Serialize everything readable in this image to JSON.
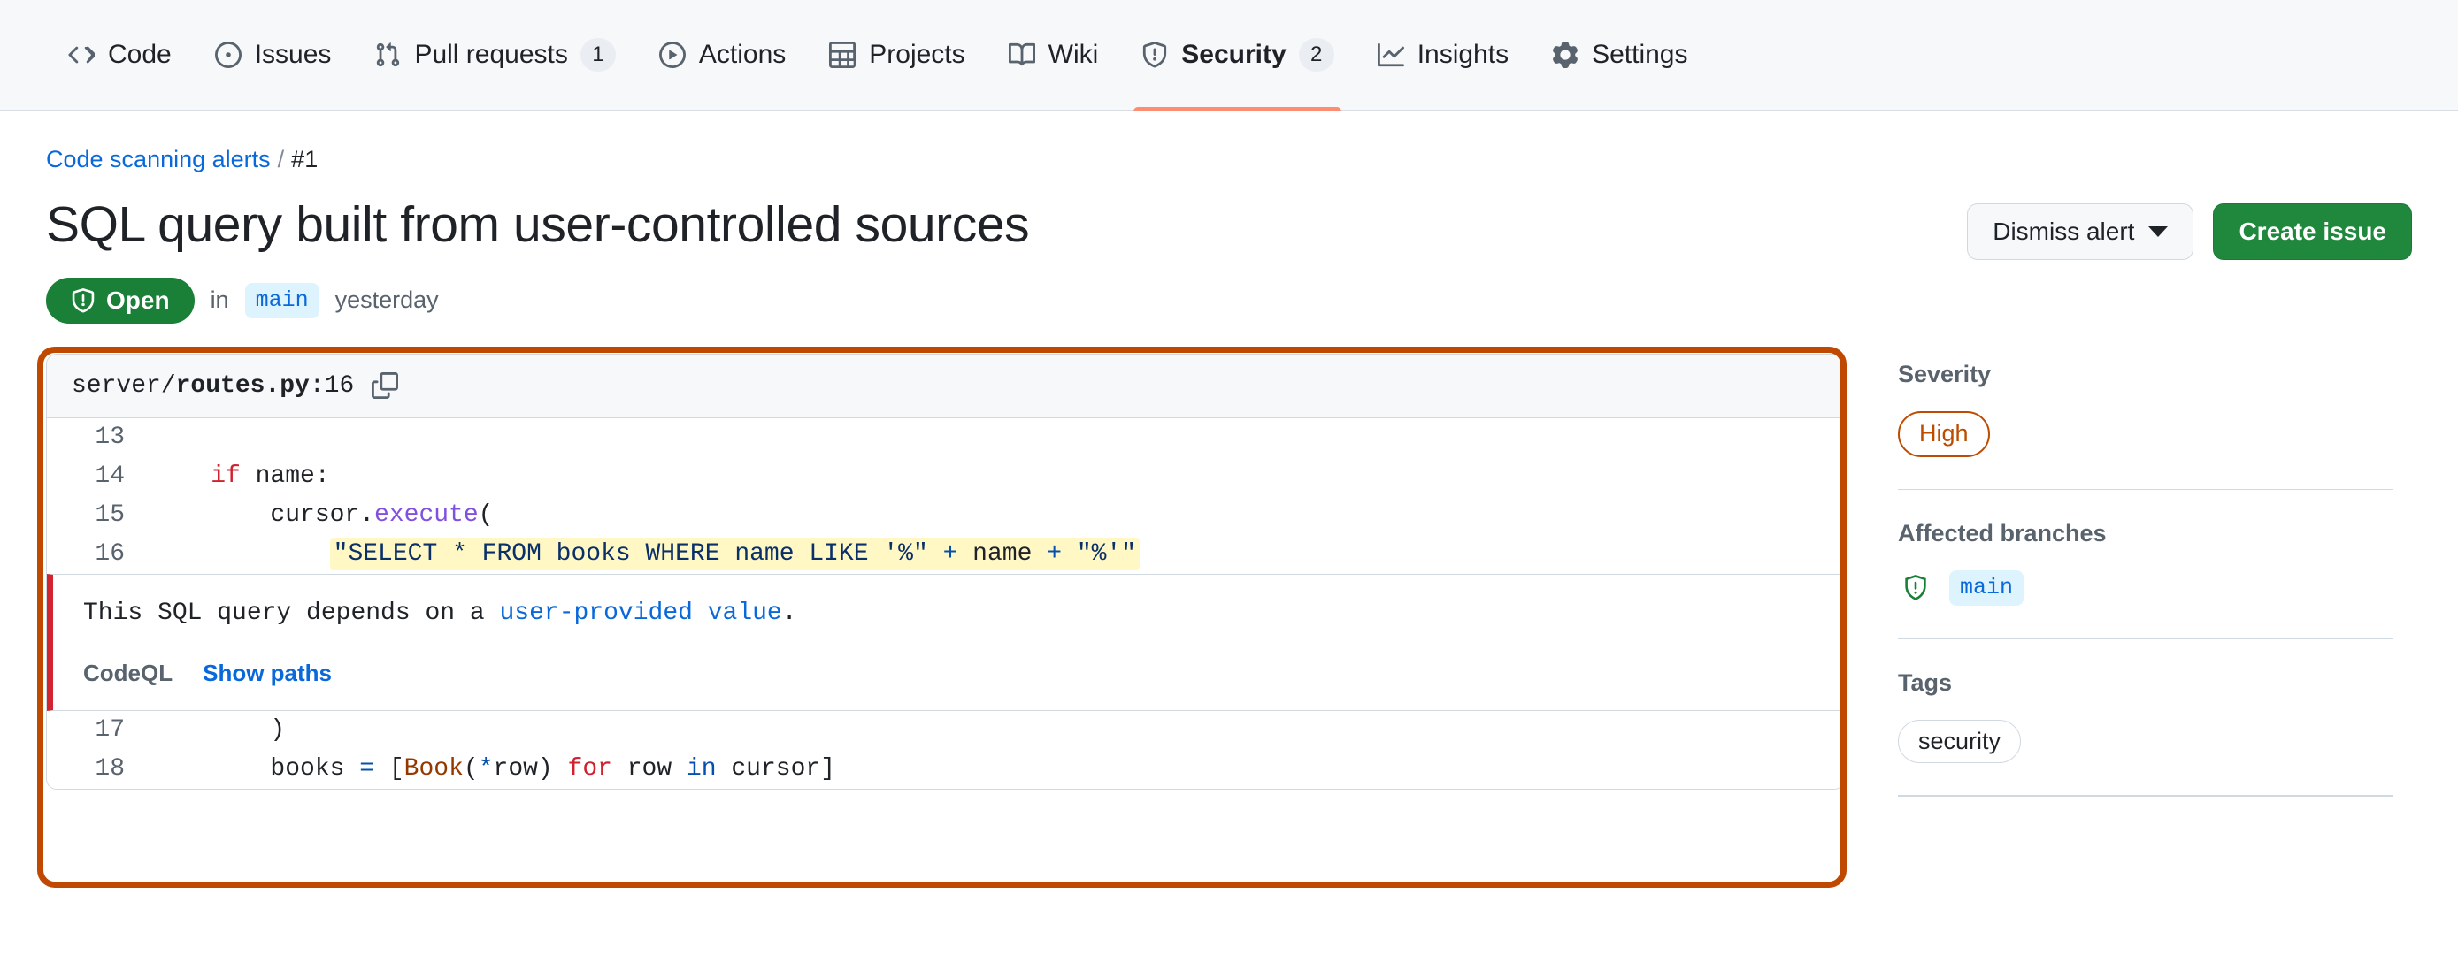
{
  "nav": {
    "tabs": [
      {
        "label": "Code",
        "icon": "code-icon",
        "count": null,
        "active": false
      },
      {
        "label": "Issues",
        "icon": "issue-opened-icon",
        "count": null,
        "active": false
      },
      {
        "label": "Pull requests",
        "icon": "git-pull-request-icon",
        "count": "1",
        "active": false
      },
      {
        "label": "Actions",
        "icon": "play-icon",
        "count": null,
        "active": false
      },
      {
        "label": "Projects",
        "icon": "table-icon",
        "count": null,
        "active": false
      },
      {
        "label": "Wiki",
        "icon": "book-icon",
        "count": null,
        "active": false
      },
      {
        "label": "Security",
        "icon": "shield-icon",
        "count": "2",
        "active": true
      },
      {
        "label": "Insights",
        "icon": "graph-icon",
        "count": null,
        "active": false
      },
      {
        "label": "Settings",
        "icon": "gear-icon",
        "count": null,
        "active": false
      }
    ]
  },
  "breadcrumb": {
    "parent": "Code scanning alerts",
    "separator": "/",
    "current": "#1"
  },
  "header": {
    "title": "SQL query built from user-controlled sources",
    "state": "Open",
    "in_word": "in",
    "branch": "main",
    "time": "yesterday",
    "dismiss_label": "Dismiss alert",
    "create_issue_label": "Create issue"
  },
  "code_panel": {
    "path_prefix": "server/",
    "file_name": "routes.py",
    "line_suffix": ":16",
    "lines_top": [
      {
        "num": "13",
        "text": ""
      },
      {
        "num": "14",
        "text": "    if name:"
      },
      {
        "num": "15",
        "text": "        cursor.execute("
      },
      {
        "num": "16",
        "text": "            \"SELECT * FROM books WHERE name LIKE '%\" + name + \"%'\""
      }
    ],
    "lines_bottom": [
      {
        "num": "17",
        "text": "        )"
      },
      {
        "num": "18",
        "text": "        books = [Book(*row) for row in cursor]"
      }
    ],
    "message_prefix": "This SQL query depends on a ",
    "message_link": "user-provided value",
    "message_suffix": ".",
    "tool": "CodeQL",
    "show_paths": "Show paths"
  },
  "sidebar": {
    "severity_heading": "Severity",
    "severity_value": "High",
    "branches_heading": "Affected branches",
    "branches": [
      "main"
    ],
    "tags_heading": "Tags",
    "tags": [
      "security"
    ]
  },
  "colors": {
    "accent": "#0969da",
    "open_green": "#1a7f37",
    "primary_green": "#1f883d",
    "severity_orange": "#bc4c00",
    "annotation_orange": "#bf4900",
    "alert_red": "#d1242f",
    "highlight_yellow": "#fff8c5",
    "active_tab": "#fd8c73"
  }
}
